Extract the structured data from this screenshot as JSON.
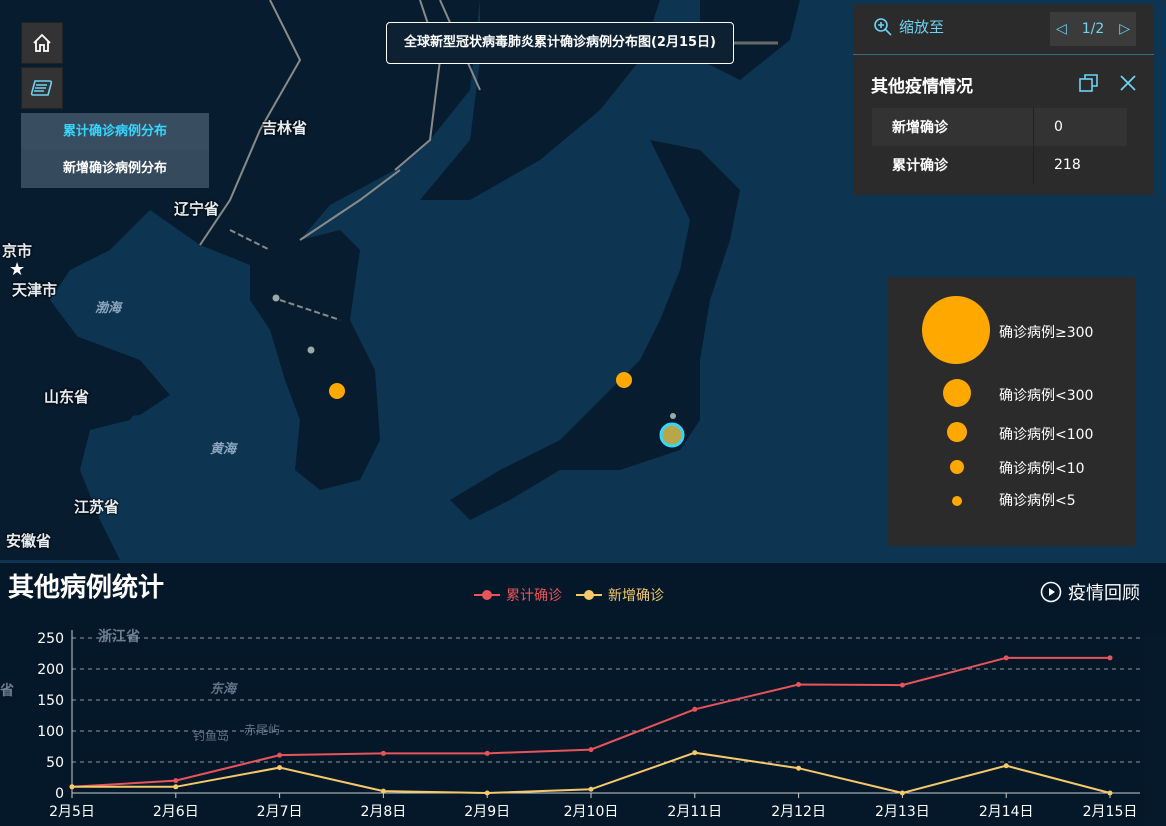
{
  "map": {
    "title": "全球新型冠状病毒肺炎累计确诊病例分布图(2月15日)",
    "labels": {
      "jilin": "吉林省",
      "liaoning": "辽宁省",
      "beijing": "京市",
      "tianjin": "天津市",
      "shandong": "山东省",
      "jiangsu": "江苏省",
      "anhui": "安徽省",
      "bohai": "渤海",
      "huanghai": "黄海",
      "zhejiang": "浙江省",
      "donghai": "东海",
      "diaoyu": "钓鱼岛",
      "chiwei": "赤尾屿",
      "sheng": "省"
    },
    "colors": {
      "ocean": "#0d3552",
      "land": "#071c2e",
      "point": "#ffa800",
      "highlight": "#35d7ff"
    }
  },
  "layers": {
    "items": [
      {
        "label": "累计确诊病例分布"
      },
      {
        "label": "新增确诊病例分布"
      }
    ]
  },
  "popup": {
    "zoom_label": "缩放至",
    "page": "1/2",
    "title": "其他疫情情况",
    "rows": [
      {
        "key": "新增确诊",
        "value": "0"
      },
      {
        "key": "累计确诊",
        "value": "218"
      }
    ]
  },
  "legend": {
    "items": [
      {
        "label": "确诊病例≥300"
      },
      {
        "label": "确诊病例<300"
      },
      {
        "label": "确诊病例<100"
      },
      {
        "label": "确诊病例<10"
      },
      {
        "label": "确诊病例<5"
      }
    ]
  },
  "panel": {
    "title": "其他病例统计",
    "replay_label": "疫情回顾"
  },
  "chart_data": {
    "type": "line",
    "title": "",
    "x": [
      "2月5日",
      "2月6日",
      "2月7日",
      "2月8日",
      "2月9日",
      "2月10日",
      "2月11日",
      "2月12日",
      "2月13日",
      "2月14日",
      "2月15日"
    ],
    "ylim": [
      0,
      250
    ],
    "yticks": [
      0,
      50,
      100,
      150,
      200,
      250
    ],
    "grid": true,
    "legend": "top-center",
    "series": [
      {
        "name": "累计确诊",
        "color": "#e8545a",
        "values": [
          10,
          20,
          61,
          64,
          64,
          70,
          135,
          175,
          174,
          218,
          218
        ]
      },
      {
        "name": "新增确诊",
        "color": "#f5c96a",
        "values": [
          10,
          10,
          41,
          3,
          0,
          6,
          65,
          40,
          0,
          44,
          0
        ]
      }
    ]
  }
}
